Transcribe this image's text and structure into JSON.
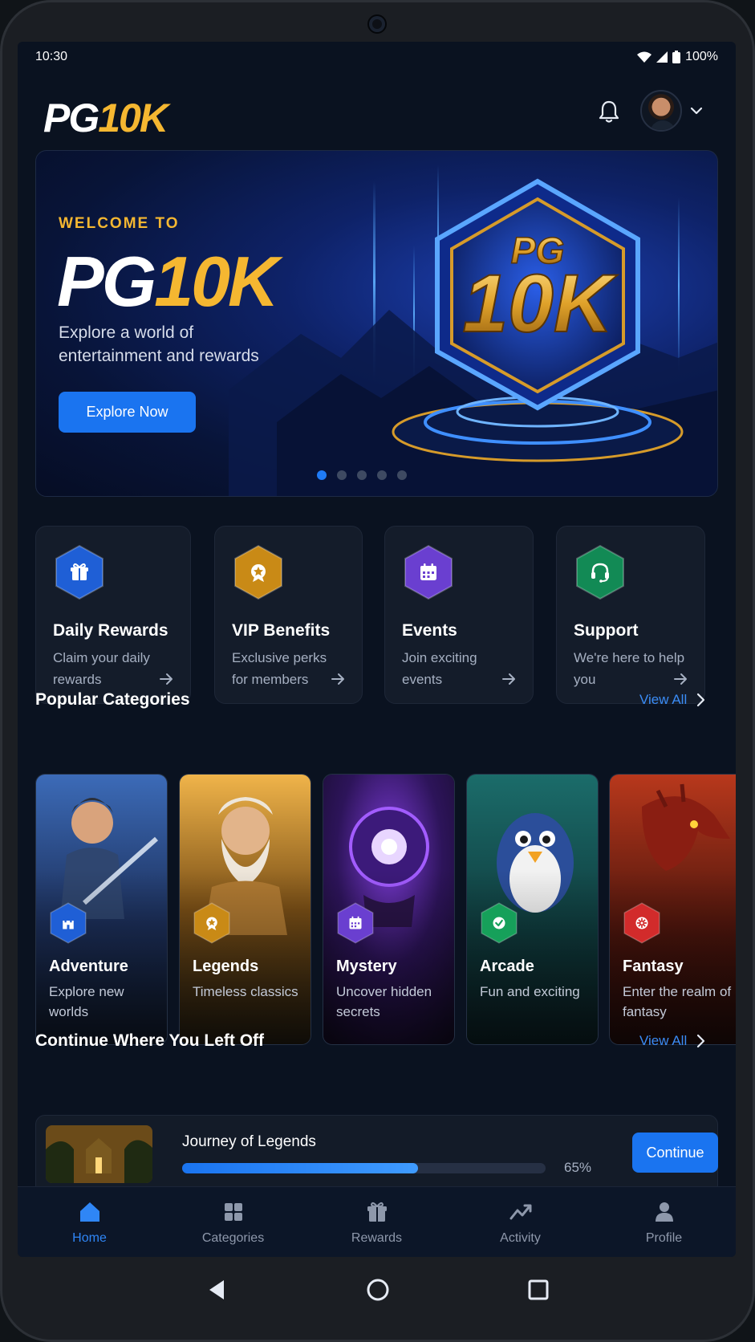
{
  "status_bar": {
    "time": "10:30",
    "battery": "100%"
  },
  "header": {
    "logo_white": "PG",
    "logo_gold": "10K"
  },
  "hero": {
    "welcome": "WELCOME TO",
    "title_white": "PG",
    "title_gold": "10K",
    "subtitle": "Explore a world of entertainment and rewards",
    "button": "Explore Now",
    "badge_top": "PG",
    "badge_main": "10K",
    "slides": 5,
    "active_slide": 1
  },
  "quick_cards": [
    {
      "title": "Daily Rewards",
      "desc": "Claim your daily rewards",
      "icon": "gift-icon",
      "color": "#1f5fd6"
    },
    {
      "title": "VIP Benefits",
      "desc": "Exclusive perks for members",
      "icon": "star-badge-icon",
      "color": "#c98a16"
    },
    {
      "title": "Events",
      "desc": "Join exciting events",
      "icon": "calendar-icon",
      "color": "#6a3fd0"
    },
    {
      "title": "Support",
      "desc": "We're here to help you",
      "icon": "headset-icon",
      "color": "#128a55"
    }
  ],
  "popular": {
    "title": "Popular Categories",
    "view_all": "View All",
    "items": [
      {
        "title": "Adventure",
        "desc": "Explore new worlds",
        "icon": "castle-icon",
        "color": "#1f5fd6"
      },
      {
        "title": "Legends",
        "desc": "Timeless classics",
        "icon": "star-badge-icon",
        "color": "#c98a16"
      },
      {
        "title": "Mystery",
        "desc": "Uncover hidden secrets",
        "icon": "calendar-icon",
        "color": "#6a3fd0"
      },
      {
        "title": "Arcade",
        "desc": "Fun and exciting",
        "icon": "check-icon",
        "color": "#16a05a"
      },
      {
        "title": "Fantasy",
        "desc": "Enter the realm of fantasy",
        "icon": "gear-icon",
        "color": "#d22b2b"
      }
    ]
  },
  "continue_section": {
    "title": "Continue Where You Left Off",
    "view_all": "View All",
    "game": "Journey of Legends",
    "progress": 0.65,
    "progress_label": "65%",
    "button": "Continue"
  },
  "bottom_nav": [
    {
      "label": "Home",
      "icon": "home-icon",
      "active": true
    },
    {
      "label": "Categories",
      "icon": "grid-icon",
      "active": false
    },
    {
      "label": "Rewards",
      "icon": "gift-icon",
      "active": false
    },
    {
      "label": "Activity",
      "icon": "trend-icon",
      "active": false
    },
    {
      "label": "Profile",
      "icon": "person-icon",
      "active": false
    }
  ]
}
